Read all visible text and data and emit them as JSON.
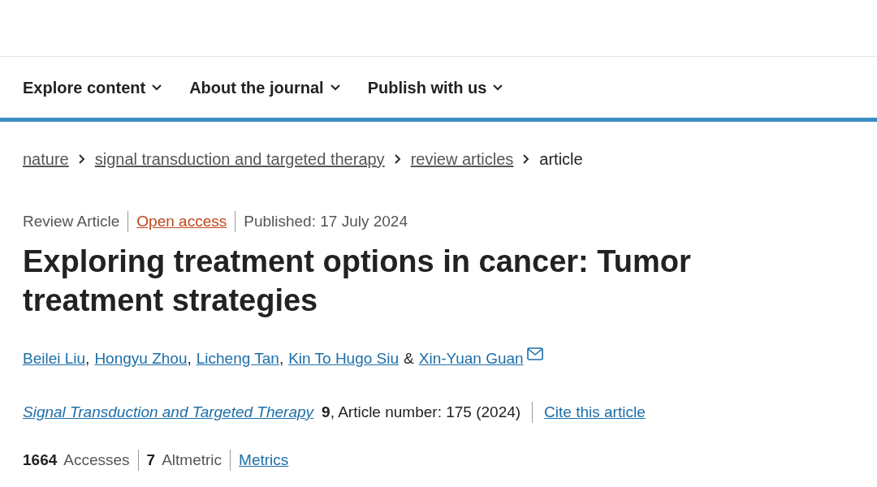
{
  "nav": [
    {
      "label": "Explore content"
    },
    {
      "label": "About the journal"
    },
    {
      "label": "Publish with us"
    }
  ],
  "breadcrumbs": [
    {
      "label": "nature",
      "link": true
    },
    {
      "label": "signal transduction and targeted therapy",
      "link": true
    },
    {
      "label": "review articles",
      "link": true
    },
    {
      "label": "article",
      "link": false
    }
  ],
  "meta": {
    "type": "Review Article",
    "access": "Open access",
    "published": "Published: 17 July 2024"
  },
  "title": "Exploring treatment options in cancer: Tumor treatment strategies",
  "authors": [
    {
      "name": "Beilei Liu",
      "sep": ","
    },
    {
      "name": "Hongyu Zhou",
      "sep": ","
    },
    {
      "name": "Licheng Tan",
      "sep": ","
    },
    {
      "name": "Kin To Hugo Siu",
      "sep": "&"
    },
    {
      "name": "Xin-Yuan Guan",
      "corresponding": true
    }
  ],
  "citation": {
    "journal": "Signal Transduction and Targeted Therapy",
    "volume": "9",
    "article": ", Article number: 175 (2024)",
    "cite": "Cite this article"
  },
  "metrics": {
    "accesses_count": "1664",
    "accesses_label": "Accesses",
    "altmetric_count": "7",
    "altmetric_label": "Altmetric",
    "link": "Metrics"
  }
}
